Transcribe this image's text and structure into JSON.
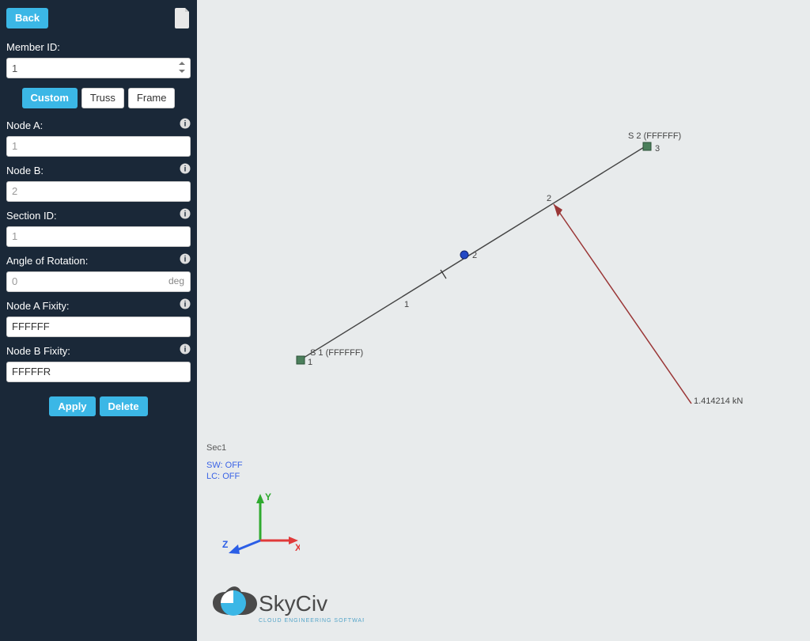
{
  "sidebar": {
    "back_label": "Back",
    "member_id_label": "Member ID:",
    "member_id_value": "1",
    "tabs": {
      "custom": "Custom",
      "truss": "Truss",
      "frame": "Frame"
    },
    "node_a_label": "Node A:",
    "node_a_value": "1",
    "node_b_label": "Node B:",
    "node_b_value": "2",
    "section_id_label": "Section ID:",
    "section_id_value": "1",
    "angle_label": "Angle of Rotation:",
    "angle_value": "0",
    "angle_unit": "deg",
    "node_a_fixity_label": "Node A Fixity:",
    "node_a_fixity_value": "FFFFFF",
    "node_b_fixity_label": "Node B Fixity:",
    "node_b_fixity_value": "FFFFFR",
    "apply_label": "Apply",
    "delete_label": "Delete"
  },
  "viewport": {
    "section_title": "Sec1",
    "sw_label": "SW:",
    "sw_value": "OFF",
    "lc_label": "LC:",
    "lc_value": "OFF",
    "axis": {
      "x": "X",
      "y": "Y",
      "z": "Z"
    }
  },
  "model": {
    "nodes": [
      {
        "id": "1",
        "label": "1",
        "annotation": "S 1 (FFFFFF)"
      },
      {
        "id": "2",
        "label": "2",
        "annotation": ""
      },
      {
        "id": "3",
        "label": "3",
        "annotation": "S 2 (FFFFFF)"
      }
    ],
    "member_labels": {
      "segment1": "1",
      "segment2": "2"
    },
    "load": {
      "magnitude": "1.414214 kN"
    }
  },
  "logo": {
    "name": "SkyCiv",
    "subtitle": "CLOUD ENGINEERING SOFTWARE"
  }
}
